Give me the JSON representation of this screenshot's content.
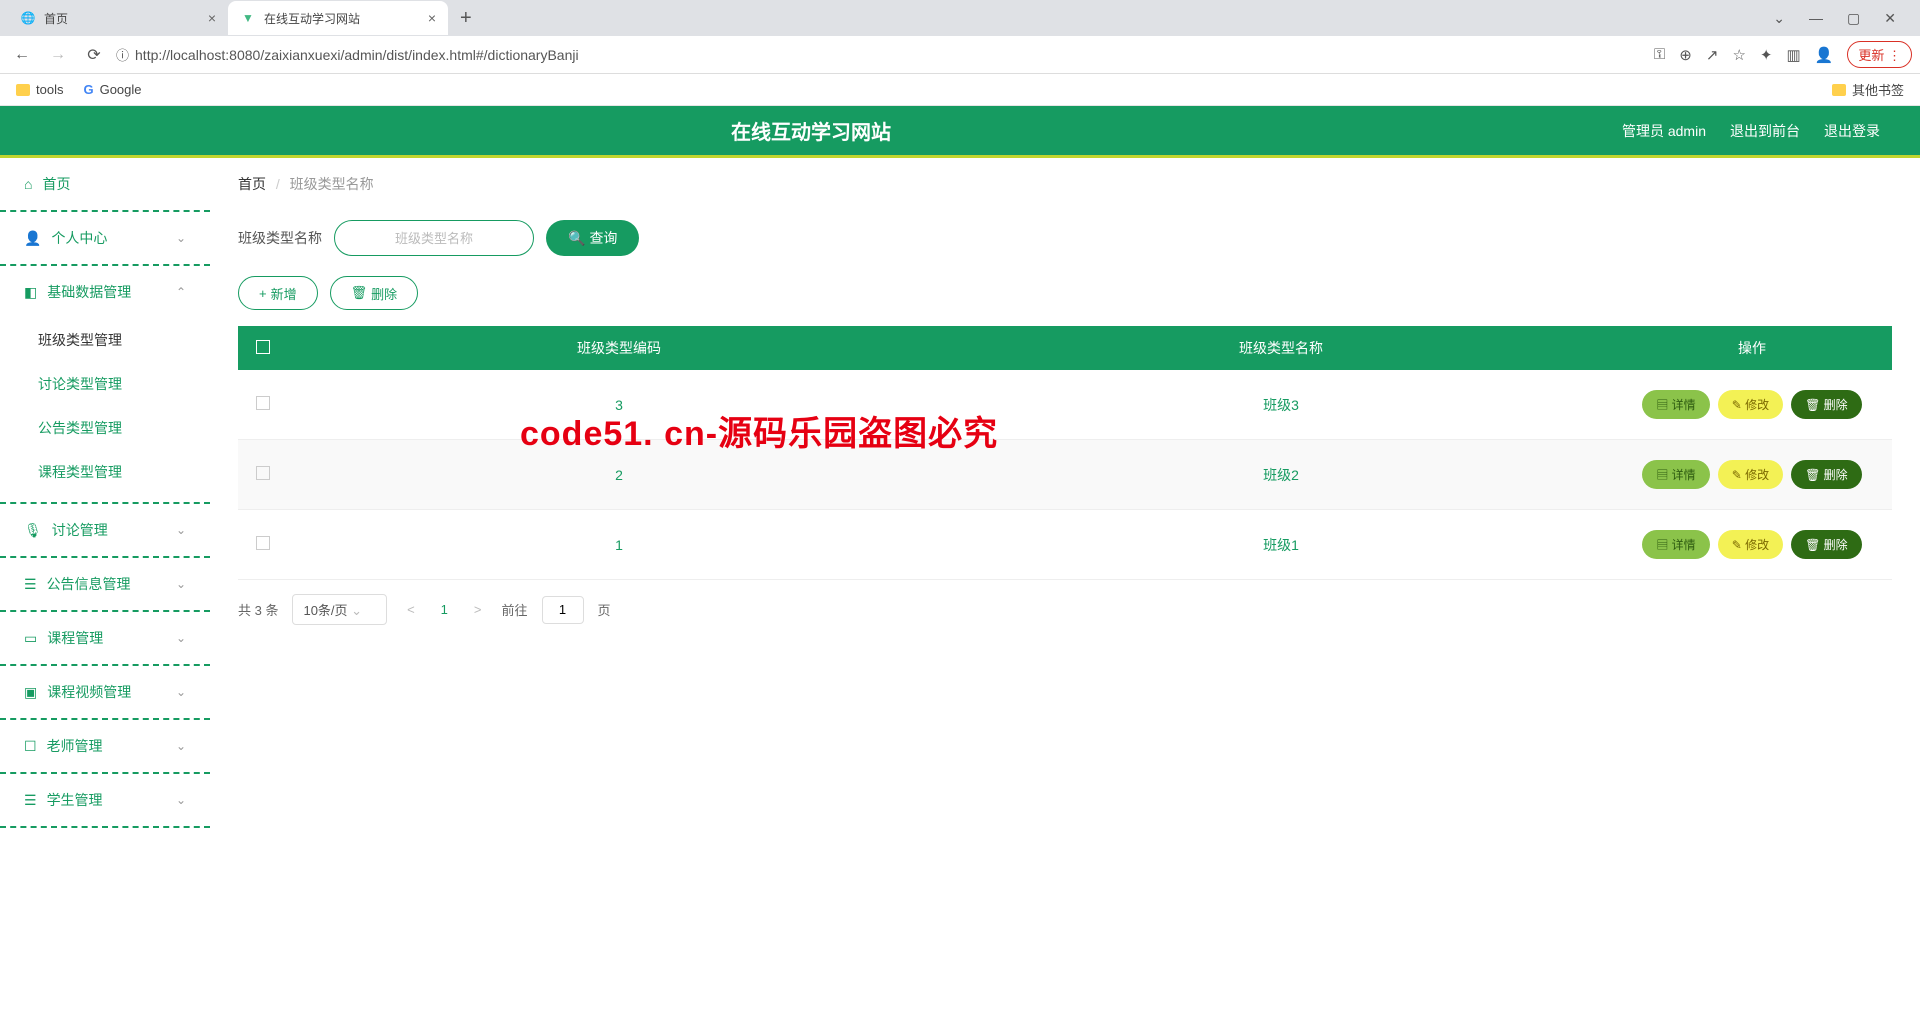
{
  "browser": {
    "tabs": [
      {
        "title": "首页",
        "active": false
      },
      {
        "title": "在线互动学习网站",
        "active": true
      }
    ],
    "url": "http://localhost:8080/zaixianxuexi/admin/dist/index.html#/dictionaryBanji",
    "update_label": "更新",
    "bookmarks": {
      "tools": "tools",
      "google": "Google",
      "other": "其他书签"
    }
  },
  "header": {
    "title": "在线互动学习网站",
    "user": "管理员 admin",
    "to_front": "退出到前台",
    "logout": "退出登录"
  },
  "sidebar": {
    "home": "首页",
    "personal": "个人中心",
    "base_data": "基础数据管理",
    "sub": {
      "class_type": "班级类型管理",
      "discuss_type": "讨论类型管理",
      "notice_type": "公告类型管理",
      "course_type": "课程类型管理"
    },
    "discuss": "讨论管理",
    "notice": "公告信息管理",
    "course": "课程管理",
    "video": "课程视频管理",
    "teacher": "老师管理",
    "student": "学生管理"
  },
  "breadcrumb": {
    "home": "首页",
    "current": "班级类型名称"
  },
  "search": {
    "label": "班级类型名称",
    "placeholder": "班级类型名称",
    "button": "查询"
  },
  "actions": {
    "add": "新增",
    "delete": "删除"
  },
  "table": {
    "headers": {
      "code": "班级类型编码",
      "name": "班级类型名称",
      "ops": "操作"
    },
    "rows": [
      {
        "code": "3",
        "name": "班级3"
      },
      {
        "code": "2",
        "name": "班级2"
      },
      {
        "code": "1",
        "name": "班级1"
      }
    ],
    "row_actions": {
      "detail": "详情",
      "edit": "修改",
      "delete": "删除"
    }
  },
  "pagination": {
    "total": "共 3 条",
    "page_size": "10条/页",
    "current": "1",
    "goto_prefix": "前往",
    "goto_value": "1",
    "goto_suffix": "页"
  },
  "watermark": "code51. cn-源码乐园盗图必究"
}
